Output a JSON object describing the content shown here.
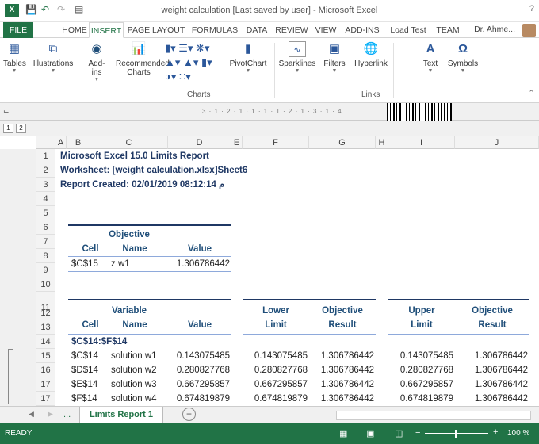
{
  "window": {
    "title": "weight calculation [Last saved by user] - Microsoft Excel",
    "help": "?"
  },
  "tabs": [
    "FILE",
    "HOME",
    "INSERT",
    "PAGE LAYOUT",
    "FORMULAS",
    "DATA",
    "REVIEW",
    "VIEW",
    "ADD-INS",
    "Load Test",
    "TEAM"
  ],
  "active_tab": "INSERT",
  "user": "Dr. Ahme...",
  "ribbon": {
    "tables": "Tables",
    "illustrations": "Illustrations",
    "addins": "Add-ins",
    "recommended_charts": "Recommended Charts",
    "pivotchart": "PivotChart",
    "sparklines": "Sparklines",
    "filters": "Filters",
    "hyperlink": "Hyperlink",
    "text": "Text",
    "symbols": "Symbols",
    "group_charts": "Charts",
    "group_links": "Links"
  },
  "ruler_text": "3 · 1 · 2 · 1 · 1 · 1 · 1 · 2 · 1 · 3 · 1 · 4",
  "outline_levels": [
    "1",
    "2"
  ],
  "columns": [
    "A",
    "B",
    "C",
    "D",
    "E",
    "F",
    "G",
    "H",
    "I",
    "J"
  ],
  "rows": [
    "1",
    "2",
    "3",
    "4",
    "5",
    "6",
    "7",
    "8",
    "9",
    "10",
    "11",
    "12",
    "13",
    "14",
    "15",
    "16",
    "17"
  ],
  "report": {
    "line1": "Microsoft Excel 15.0 Limits Report",
    "line2": "Worksheet: [weight calculation.xlsx]Sheet6",
    "line3": "Report Created: 02/01/2019 08:12:14 م",
    "objective_header_top": "Objective",
    "h_cell": "Cell",
    "h_name": "Name",
    "h_value": "Value",
    "obj_cell": "$C$15",
    "obj_name": "z w1",
    "obj_value": "1.306786442",
    "variable_header_top": "Variable",
    "lower_top": "Lower",
    "lower_bottom": "Limit",
    "objres_top": "Objective",
    "objres_bottom": "Result",
    "upper_top": "Upper",
    "upper_bottom": "Limit",
    "range_label": "$C$14:$F$14",
    "variables": [
      {
        "cell": "$C$14",
        "name": "solution w1",
        "value": "0.143075485",
        "lower": "0.143075485",
        "lower_res": "1.306786442",
        "upper": "0.143075485",
        "upper_res": "1.306786442"
      },
      {
        "cell": "$D$14",
        "name": "solution w2",
        "value": "0.280827768",
        "lower": "0.280827768",
        "lower_res": "1.306786442",
        "upper": "0.280827768",
        "upper_res": "1.306786442"
      },
      {
        "cell": "$E$14",
        "name": "solution w3",
        "value": "0.667295857",
        "lower": "0.667295857",
        "lower_res": "1.306786442",
        "upper": "0.667295857",
        "upper_res": "1.306786442"
      },
      {
        "cell": "$F$14",
        "name": "solution w4",
        "value": "0.674819879",
        "lower": "0.674819879",
        "lower_res": "1.306786442",
        "upper": "0.674819879",
        "upper_res": "1.306786442"
      }
    ]
  },
  "sheet": {
    "ellipsis": "...",
    "tab": "Limits Report 1",
    "add": "+"
  },
  "status": {
    "ready": "READY",
    "zoom": "100 %"
  },
  "colors": {
    "excel_green": "#217346",
    "header_blue": "#1f4e79"
  }
}
